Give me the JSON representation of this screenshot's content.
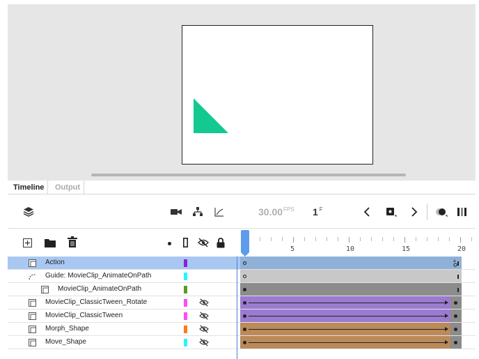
{
  "panel_tabs": {
    "timeline": "Timeline",
    "output": "Output"
  },
  "toolbar": {
    "fps_value": "30.00",
    "fps_unit": "FPS",
    "frame_value": "1",
    "frame_unit": "F"
  },
  "ruler": {
    "labels": [
      "5",
      "10",
      "15",
      "20"
    ]
  },
  "layers": [
    {
      "name": "Action",
      "color": "#8a22d8",
      "hidden": false,
      "selected": true,
      "type": "normal"
    },
    {
      "name": "Guide: MovieClip_AnimateOnPath",
      "color": "#29f4ff",
      "hidden": false,
      "selected": false,
      "type": "guide"
    },
    {
      "name": "MovieClip_AnimateOnPath",
      "color": "#5c9a1c",
      "hidden": false,
      "selected": false,
      "type": "guided"
    },
    {
      "name": "MovieClip_ClassicTween_Rotate",
      "color": "#ff4cf4",
      "hidden": true,
      "selected": false,
      "type": "normal"
    },
    {
      "name": "MovieClip_ClassicTween",
      "color": "#ff4cf4",
      "hidden": true,
      "selected": false,
      "type": "normal"
    },
    {
      "name": "Morph_Shape",
      "color": "#ff7a14",
      "hidden": true,
      "selected": false,
      "type": "normal"
    },
    {
      "name": "Move_Shape",
      "color": "#29f4ff",
      "hidden": true,
      "selected": false,
      "type": "normal"
    }
  ],
  "colors": {
    "shape_fill": "#13c98f",
    "playhead": "#5d9ceb",
    "selected_row": "#a8c8f2",
    "frames_action": "#8fb1d8",
    "frames_guide": "#c8c8c8",
    "frames_guided": "#8c8c8c",
    "frames_classic_tween": "#9b7bd0",
    "frames_shape_tween": "#bb8a5a"
  }
}
